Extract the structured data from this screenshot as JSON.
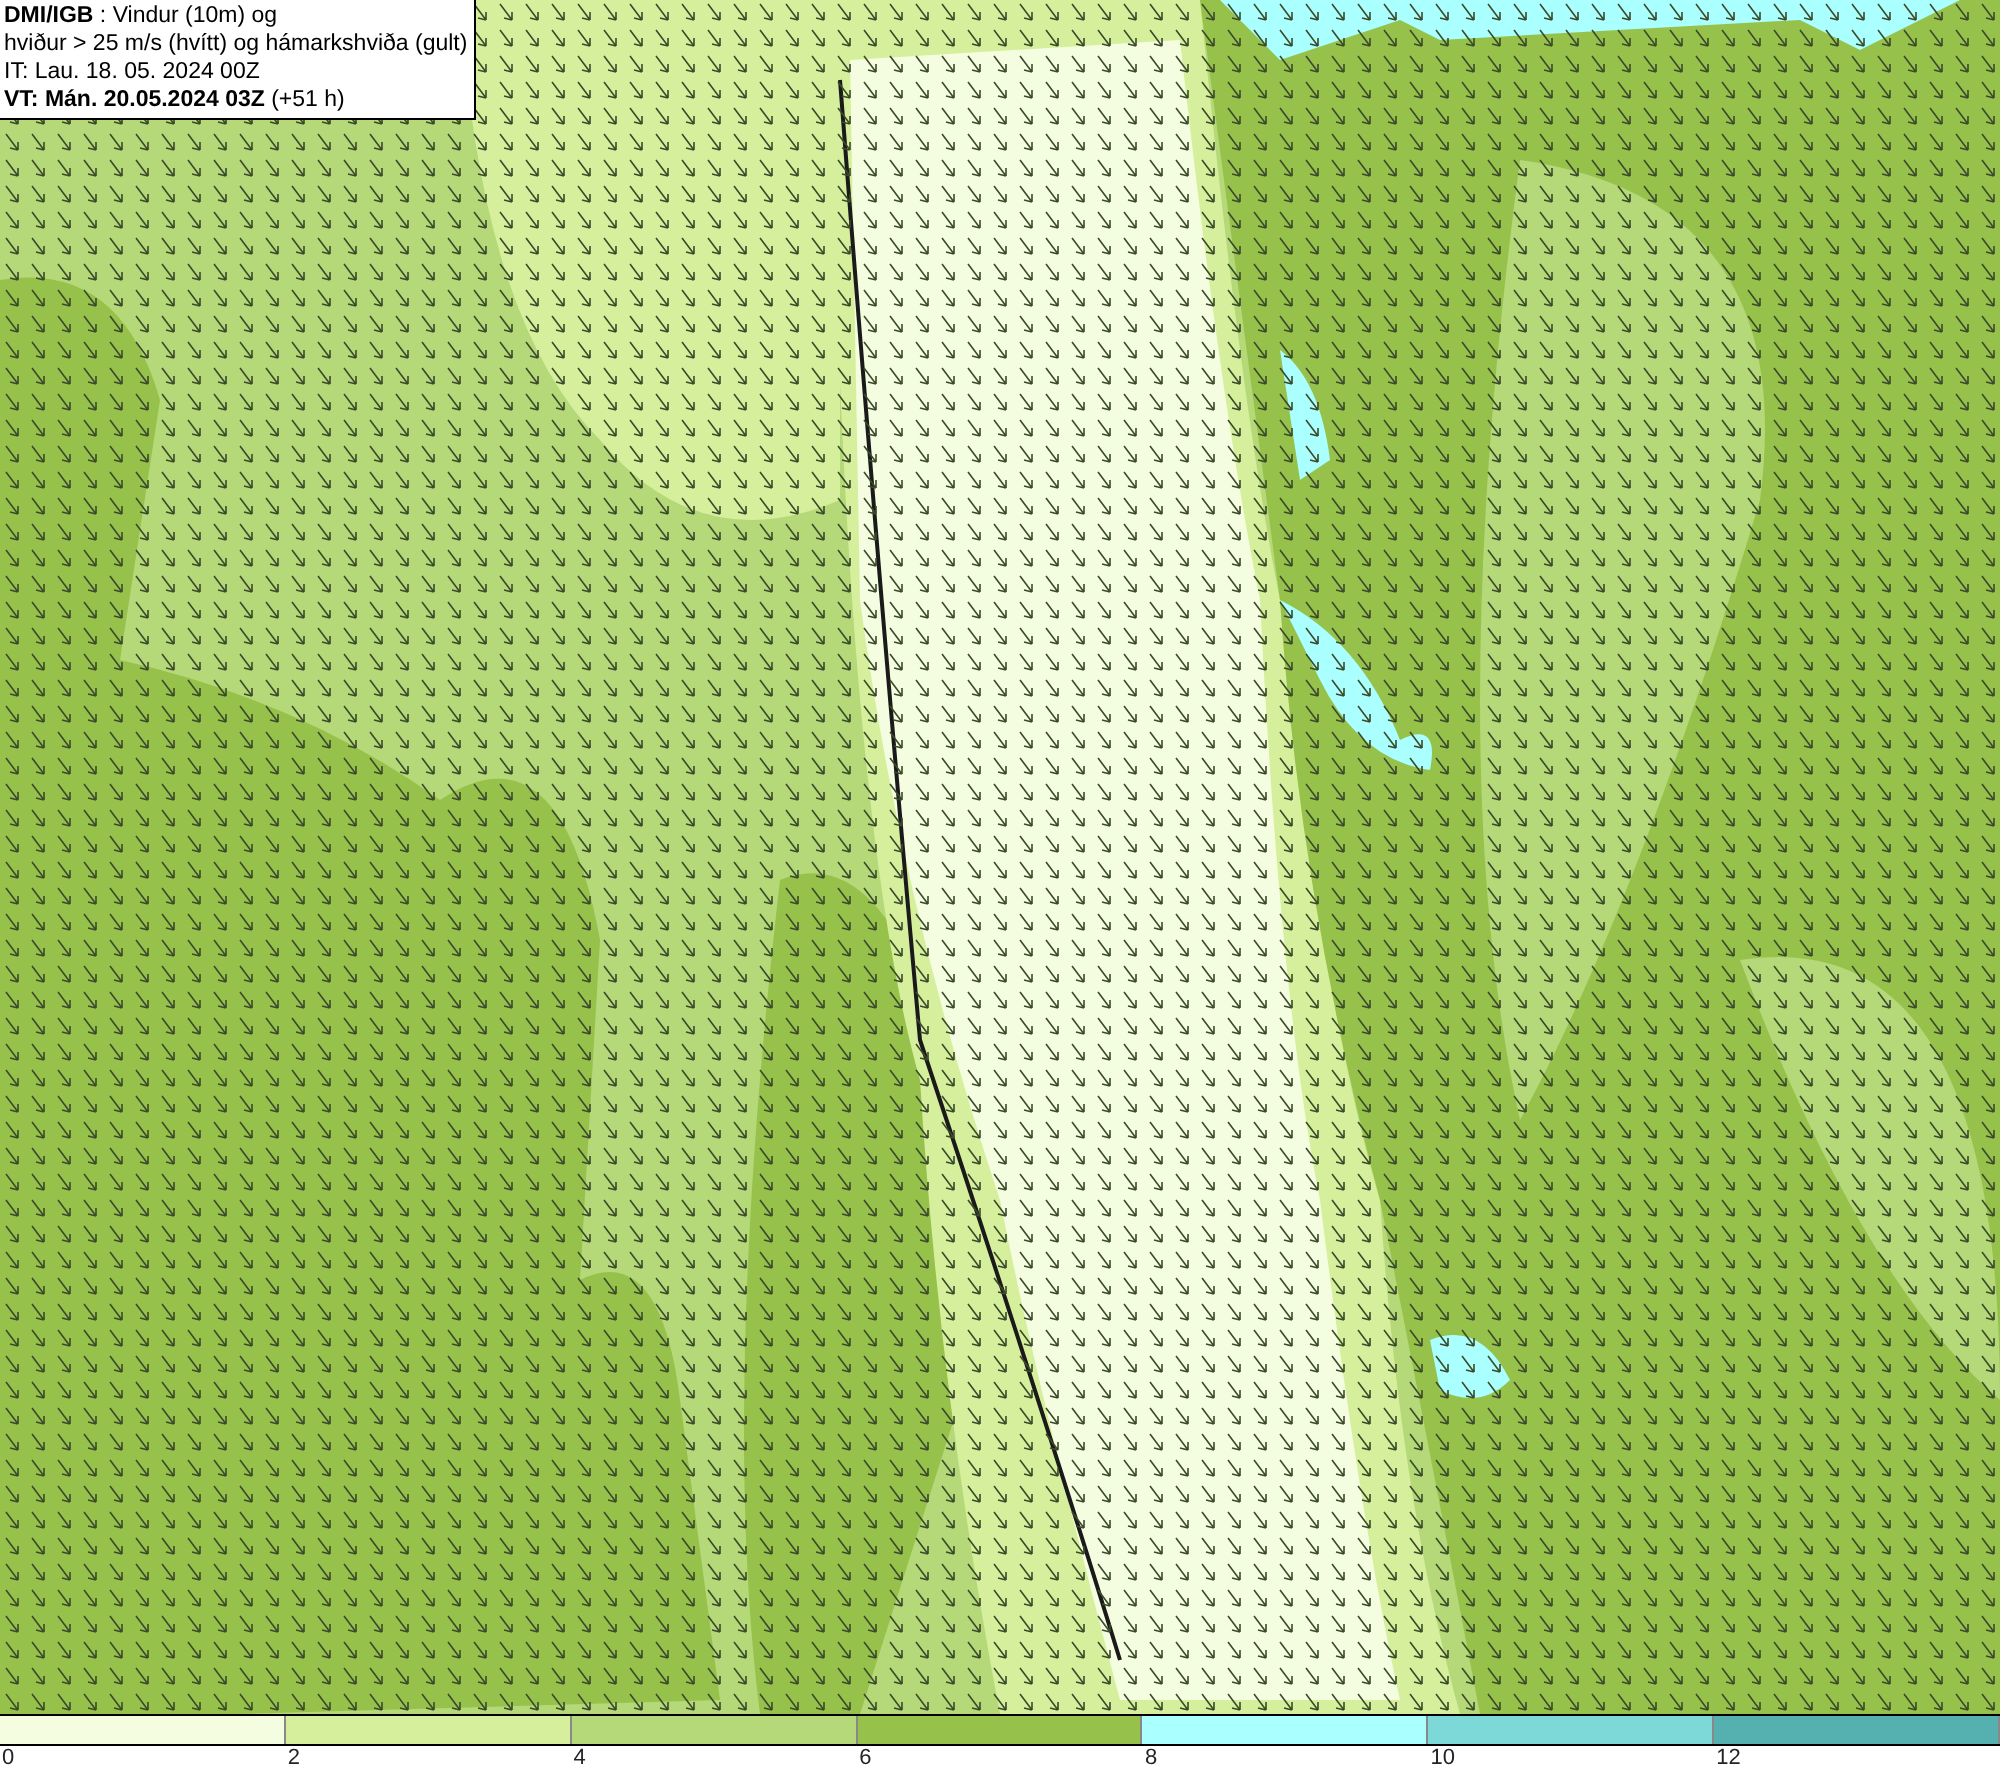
{
  "title_box": {
    "lines": [
      "**DMI/IGB** : Vindur (10m) og",
      "hviður > 25 m/s (hvítt) og hámarkshviða (gult)",
      "IT: Lau. 18. 05. 2024 00Z",
      "**VT: Mán. 20.05.2024 03Z** (+51 h)"
    ]
  },
  "legend": {
    "bins": [
      {
        "color": "#f5fde0"
      },
      {
        "color": "#d6ef9c"
      },
      {
        "color": "#b5d878"
      },
      {
        "color": "#96c14a"
      },
      {
        "color": "#aaffff"
      },
      {
        "color": "#7dd8d8"
      },
      {
        "color": "#55b0b0"
      }
    ],
    "ticks": [
      "0",
      "2",
      "4",
      "6",
      "8",
      "10",
      "12"
    ]
  }
}
